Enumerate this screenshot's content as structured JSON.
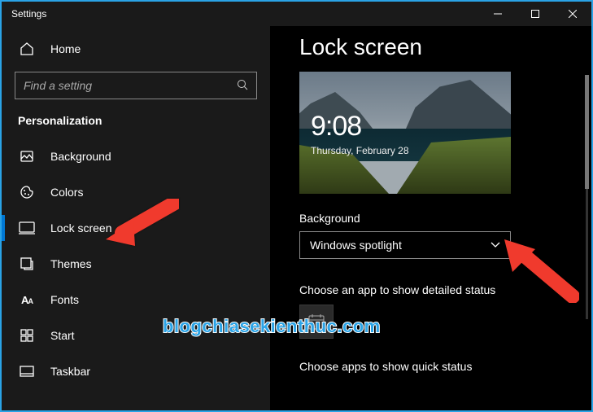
{
  "window": {
    "title": "Settings"
  },
  "sidebar": {
    "home_label": "Home",
    "search_placeholder": "Find a setting",
    "category": "Personalization",
    "items": [
      {
        "label": "Background"
      },
      {
        "label": "Colors"
      },
      {
        "label": "Lock screen"
      },
      {
        "label": "Themes"
      },
      {
        "label": "Fonts"
      },
      {
        "label": "Start"
      },
      {
        "label": "Taskbar"
      }
    ]
  },
  "page": {
    "title": "Lock screen",
    "preview": {
      "time": "9:08",
      "date": "Thursday, February 28"
    },
    "background_label": "Background",
    "background_value": "Windows spotlight",
    "detailed_status_label": "Choose an app to show detailed status",
    "quick_status_label": "Choose apps to show quick status"
  },
  "annotation": {
    "watermark": "blogchiasekienthuc.com"
  }
}
